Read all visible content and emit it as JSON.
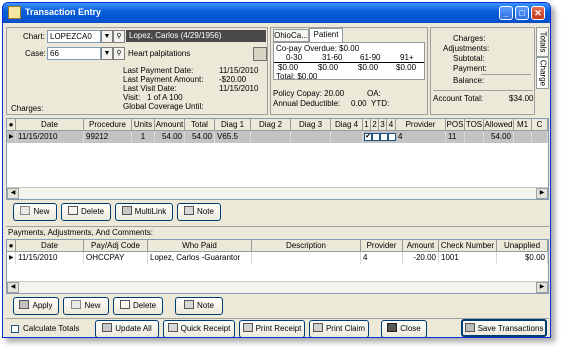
{
  "window": {
    "title": "Transaction Entry",
    "controls": [
      "_",
      "□",
      "✕"
    ]
  },
  "patient": {
    "chart_label": "Chart:",
    "chart_value": "LOPEZCA0",
    "name": "Lopez, Carlos (4/29/1956)",
    "case_label": "Case:",
    "case_value": "66",
    "case_desc": "Heart palpitations",
    "last_payment_date_label": "Last Payment Date:",
    "last_payment_date": "11/15/2010",
    "last_payment_amount_label": "Last Payment Amount:",
    "last_payment_amount": "-$20.00",
    "last_visit_date_label": "Last Visit Date:",
    "last_visit_date": "11/15/2010",
    "visit_label": "Visit:",
    "visit_value": "1 of A 100",
    "global_coverage_label": "Global Coverage Until:",
    "charges_label": "Charges:"
  },
  "aging": {
    "tabs": [
      "OhioCa...",
      "Patient"
    ],
    "copay_overdue": "Co-pay Overdue: $0.00",
    "buckets": [
      "0-30",
      "31-60",
      "61-90",
      "91+"
    ],
    "values": [
      "$0.00",
      "$0.00",
      "$0.00",
      "$0.00"
    ],
    "total": "Total: $0.00",
    "policy_copay": "Policy Copay: 20.00",
    "oa": "OA:",
    "annual_deductible": "Annual Deductible:",
    "annual_deductible_value": "0.00",
    "ytd": "YTD:"
  },
  "totals": {
    "charges": "Charges:",
    "adjustments": "Adjustments:",
    "subtotal": "Subtotal:",
    "payment": "Payment:",
    "balance": "Balance:",
    "account_total_label": "Account Total:",
    "account_total": "$34.00",
    "side_tabs": [
      "Totals",
      "Charge"
    ]
  },
  "charges_grid": {
    "headers": [
      "●",
      "Date",
      "Procedure",
      "Units",
      "Amount",
      "Total",
      "Diag 1",
      "Diag 2",
      "Diag 3",
      "Diag 4",
      "1",
      "2",
      "3",
      "4",
      "Provider",
      "POS",
      "TOS",
      "Allowed",
      "M1",
      "C"
    ],
    "row": [
      "11/15/2010",
      "99212",
      "1",
      "54.00",
      "54.00",
      "V65.5",
      "",
      "",
      "",
      "",
      "✔",
      "",
      "",
      "",
      "4",
      "11",
      "",
      "54.00",
      "",
      ""
    ]
  },
  "charge_buttons": [
    "New",
    "Delete",
    "MultiLink",
    "Note"
  ],
  "payments_label": "Payments, Adjustments, And Comments:",
  "payments_grid": {
    "headers": [
      "●",
      "Date",
      "Pay/Adj Code",
      "Who Paid",
      "Description",
      "Provider",
      "Amount",
      "Check Number",
      "Unapplied"
    ],
    "row": [
      "11/15/2010",
      "OHCCPAY",
      "Lopez, Carlos -Guarantor",
      "",
      "4",
      "-20.00",
      "1001",
      "$0.00"
    ]
  },
  "payment_buttons": [
    "Apply",
    "New",
    "Delete",
    "Note"
  ],
  "bottom": {
    "calculate_totals": "Calculate Totals",
    "buttons": [
      "Update All",
      "Quick Receipt",
      "Print Receipt",
      "Print Claim",
      "Close",
      "Save Transactions"
    ]
  }
}
